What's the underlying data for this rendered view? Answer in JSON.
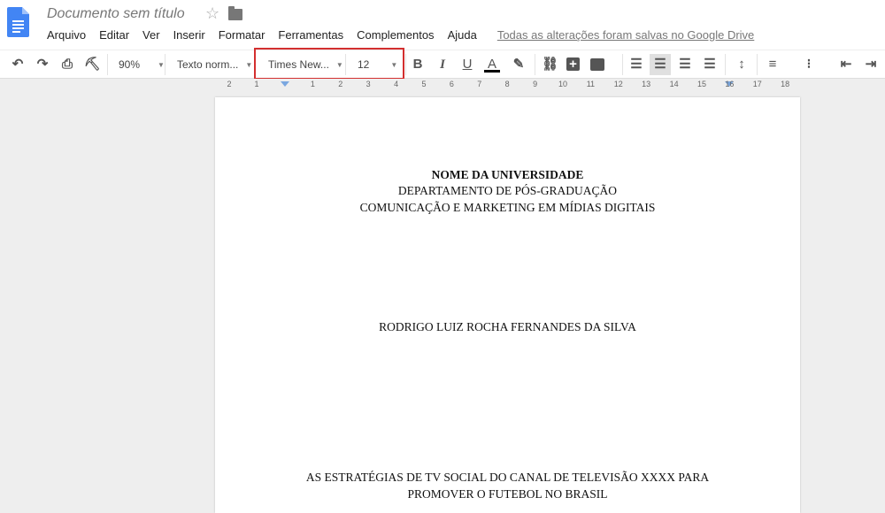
{
  "header": {
    "title": "Documento sem título",
    "saved_status": "Todas as alterações foram salvas no Google Drive"
  },
  "menu": [
    "Arquivo",
    "Editar",
    "Ver",
    "Inserir",
    "Formatar",
    "Ferramentas",
    "Complementos",
    "Ajuda"
  ],
  "toolbar": {
    "zoom": "90%",
    "style": "Texto norm...",
    "font": "Times New...",
    "size": "12"
  },
  "ruler": {
    "left": [
      "2",
      "1"
    ],
    "right": [
      "1",
      "2",
      "3",
      "4",
      "5",
      "6",
      "7",
      "8",
      "9",
      "10",
      "11",
      "12",
      "13",
      "14",
      "15",
      "16",
      "17",
      "18"
    ]
  },
  "document": {
    "lines": [
      "NOME DA UNIVERSIDADE",
      "DEPARTAMENTO DE PÓS-GRADUAÇÃO",
      "COMUNICAÇÃO E MARKETING EM MÍDIAS DIGITAIS",
      "RODRIGO LUIZ ROCHA FERNANDES DA SILVA",
      "AS ESTRATÉGIAS DE TV SOCIAL DO CANAL DE TELEVISÃO XXXX PARA",
      "PROMOVER O FUTEBOL NO BRASIL"
    ]
  },
  "colors": {
    "highlight_box": "#d32f2f",
    "docs_blue": "#4285f4"
  }
}
